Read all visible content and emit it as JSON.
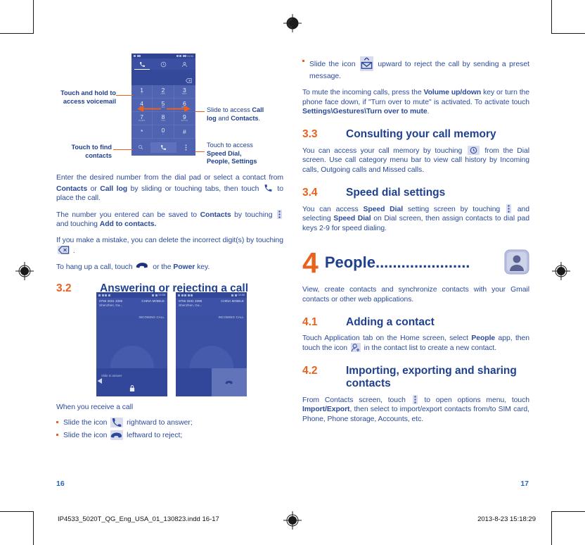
{
  "document": {
    "left_page_number": "16",
    "right_page_number": "17",
    "footer_file": "IP4533_5020T_QG_Eng_USA_01_130823.indd   16-17",
    "footer_date": "2013-8-23   15:18:29"
  },
  "colors": {
    "accent_orange": "#e8611d",
    "heading_blue": "#1f3f8f",
    "body_blue": "#2b4a9b",
    "page_number_blue": "#2b64b8",
    "screenshot_blue": "#3d52a4"
  },
  "left_column": {
    "dialpad_annotations": {
      "voicemail": "Touch and hold to access voicemail",
      "voicemail_line1": "Touch and hold to",
      "voicemail_line2": "access voicemail",
      "find_contacts_line1": "Touch to find",
      "find_contacts_line2": "contacts",
      "slide_access_line1_plain": "Slide to access ",
      "slide_access_line1_bold": "Call",
      "slide_access_line2_bold1": "log",
      "slide_access_line2_plain": " and ",
      "slide_access_line2_bold2": "Contacts",
      "touch_access_plain": "Touch to access",
      "touch_access_bold1": "Speed Dial,",
      "touch_access_bold2": "People, Settings"
    },
    "dialpad_screenshot": {
      "status_time": "04:58",
      "keys": [
        {
          "digit": "1",
          "letters": "∞"
        },
        {
          "digit": "2",
          "letters": "ABC"
        },
        {
          "digit": "3",
          "letters": "DEF"
        },
        {
          "digit": "4",
          "letters": "GHI"
        },
        {
          "digit": "5",
          "letters": "JKL"
        },
        {
          "digit": "6",
          "letters": "MNO"
        },
        {
          "digit": "7",
          "letters": "PQRS"
        },
        {
          "digit": "8",
          "letters": "TUV"
        },
        {
          "digit": "9",
          "letters": "WXYZ"
        },
        {
          "digit": "*",
          "letters": ""
        },
        {
          "digit": "0",
          "letters": "+"
        },
        {
          "digit": "#",
          "letters": ""
        }
      ]
    },
    "paragraphs": {
      "p1_a": "Enter the desired number from the dial pad or select a contact from ",
      "p1_b": "Contacts",
      "p1_c": " or ",
      "p1_d": "Call log",
      "p1_e": " by sliding or touching tabs, then touch ",
      "p1_f": " to place the call.",
      "p2_a": "The number you entered can be saved to ",
      "p2_b": "Contacts",
      "p2_c": " by touching ",
      "p2_d": " and touching ",
      "p2_e": "Add to contacts.",
      "p3_a": "If you make a mistake, you can delete the incorrect digit(s) by touching ",
      "p3_b": " .",
      "p4_a": "To hang up a call, touch ",
      "p4_b": " or the ",
      "p4_c": "Power",
      "p4_d": " key."
    },
    "section_3_2": {
      "number": "3.2",
      "title": "Answering or rejecting a call"
    },
    "call_screenshots": [
      {
        "number": "0755 3331 3395",
        "location": "Shenzhen, Ga...",
        "carrier": "CHINA MOBILE",
        "state": "INCOMING CALL",
        "slide_hint": "Slide to answer",
        "time": "04:58"
      },
      {
        "number": "0755 3331 3395",
        "location": "Shenzhen, Ga...",
        "carrier": "CHINA MOBILE",
        "state": "INCOMING CALL",
        "slide_hint": "",
        "time": "04:58"
      }
    ],
    "receive_heading": "When you receive a call",
    "bullets": [
      {
        "a": "Slide the icon ",
        "b": " rightward to answer;"
      },
      {
        "a": "Slide the icon ",
        "b": " leftward to reject;"
      }
    ]
  },
  "right_column": {
    "bullet_preset": {
      "a": "Slide the icon ",
      "b": " upward to reject the call by sending a preset message."
    },
    "mute_paragraph": {
      "a": "To mute the incoming calls, press the ",
      "b": "Volume up/down",
      "c": " key or turn the phone face down, if \"Turn over to mute\" is activated. To activate touch ",
      "d": "Settings\\Gestures\\Turn over to mute",
      "e": "."
    },
    "section_3_3": {
      "number": "3.3",
      "title": "Consulting your call memory",
      "body_a": "You can access your call memory by touching ",
      "body_b": " from the Dial screen. Use call category menu bar to view call history by Incoming calls, Outgoing calls and Missed calls."
    },
    "section_3_4": {
      "number": "3.4",
      "title": "Speed dial settings",
      "body_a": "You can access ",
      "body_b": "Speed Dial",
      "body_c": " setting screen by touching ",
      "body_d": " and selecting ",
      "body_e": "Speed Dial",
      "body_f": " on Dial screen, then assign contacts to dial pad keys 2-9 for speed dialing."
    },
    "chapter_4": {
      "number": "4",
      "title": "People",
      "dots": "......................",
      "icon": "people-icon",
      "intro": "View, create contacts and synchronize contacts with your Gmail contacts or other web applications."
    },
    "section_4_1": {
      "number": "4.1",
      "title": "Adding a contact",
      "body_a": "Touch Application tab on the Home screen, select ",
      "body_b": "People",
      "body_c": " app, then touch the icon ",
      "body_d": " in the contact list to create a new contact."
    },
    "section_4_2": {
      "number": "4.2",
      "title_line1": "Importing, exporting and sharing",
      "title_line2": "contacts",
      "body_a": "From Contacts screen, touch ",
      "body_b": " to open options menu, touch ",
      "body_c": "Import/Export",
      "body_d": ", then select to import/export contacts from/to SIM card, Phone, Phone storage, Accounts, etc."
    }
  }
}
